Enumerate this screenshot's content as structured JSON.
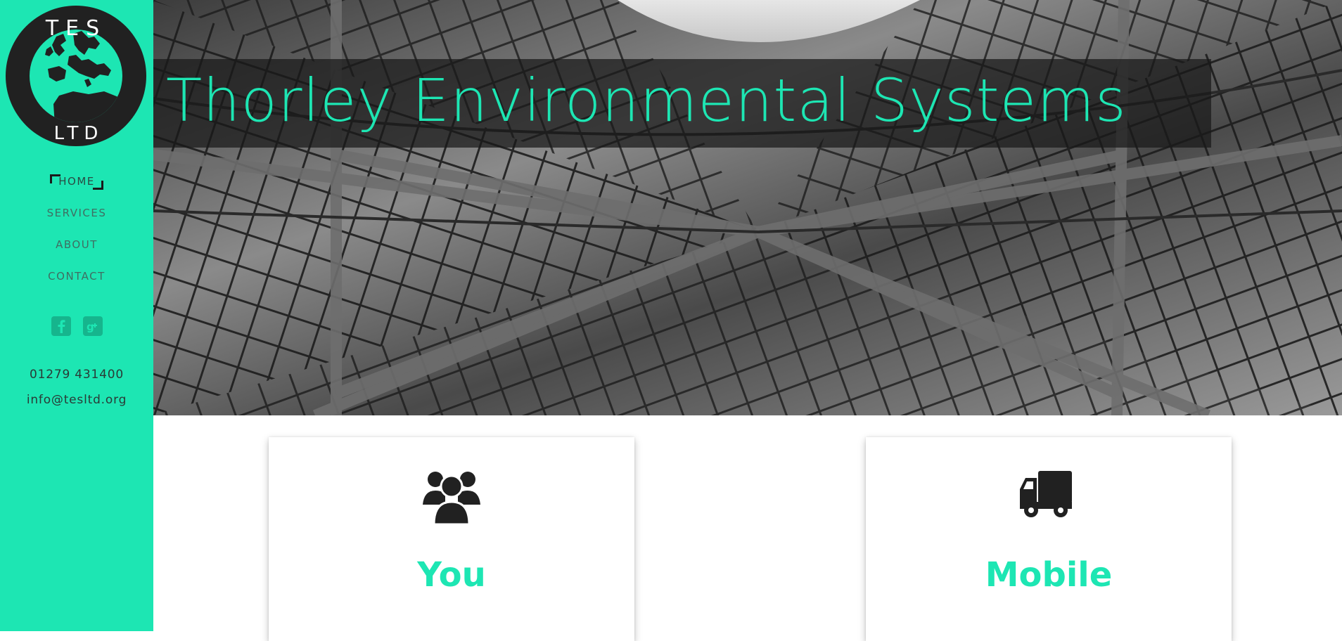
{
  "logo": {
    "top_text": "TES",
    "bottom_text": "LTD"
  },
  "nav": {
    "items": [
      {
        "label": "HOME",
        "active": true
      },
      {
        "label": "SERVICES",
        "active": false
      },
      {
        "label": "ABOUT",
        "active": false
      },
      {
        "label": "CONTACT",
        "active": false
      }
    ]
  },
  "social": [
    {
      "icon": "facebook-icon"
    },
    {
      "icon": "google-plus-icon"
    }
  ],
  "contact": {
    "phone": "01279 431400",
    "email": "info@tesltd.org"
  },
  "hero": {
    "title": "Thorley Environmental Systems"
  },
  "cards": [
    {
      "title": "You",
      "icon": "users-icon"
    },
    {
      "title": "Mobile",
      "icon": "truck-icon"
    }
  ],
  "colors": {
    "accent": "#1de6b3",
    "dark": "#212121",
    "sidebar_text": "#3f6e62"
  }
}
